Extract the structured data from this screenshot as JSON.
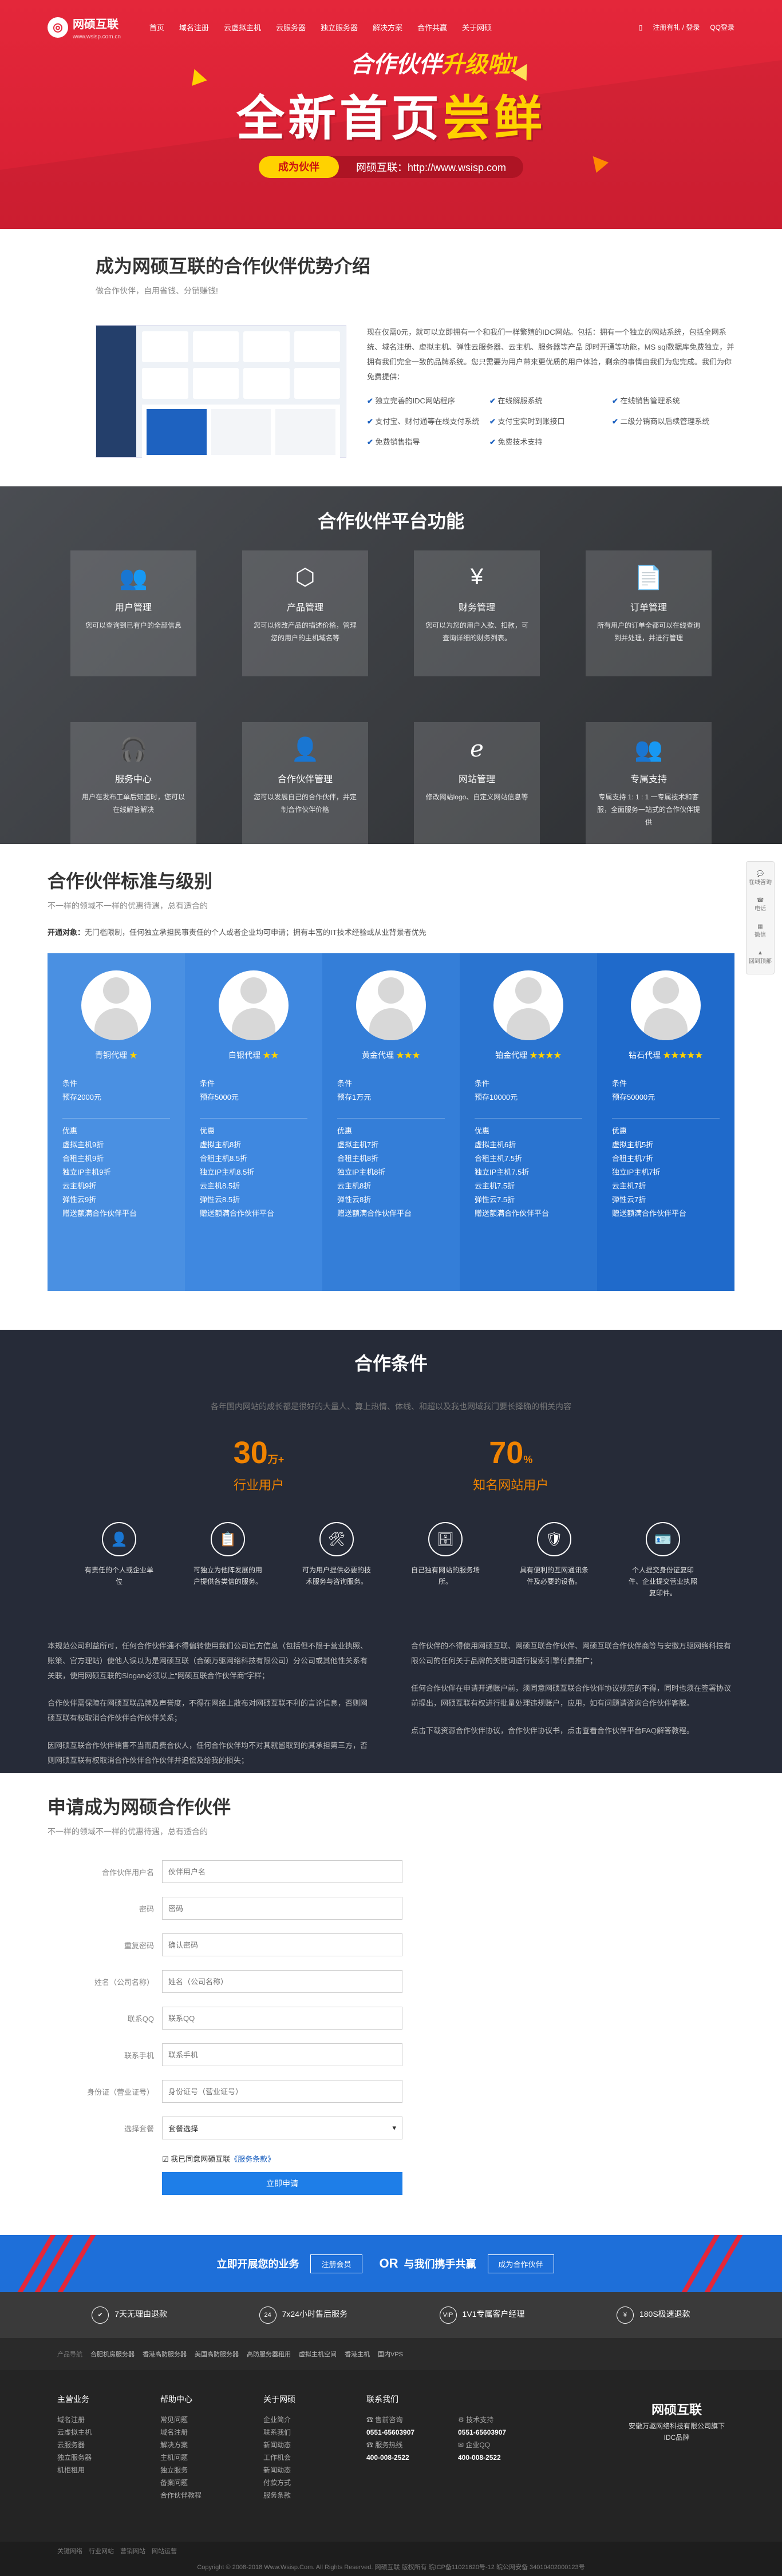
{
  "header": {
    "logo_name": "网硕互联",
    "logo_sub": "www.wsisp.com.cn",
    "nav": [
      "首页",
      "域名注册",
      "云虚拟主机",
      "云服务器",
      "独立服务器",
      "解决方案",
      "合作共赢",
      "关于网硕"
    ],
    "right": [
      "注册有礼 / 登录",
      "QQ登录"
    ]
  },
  "hero": {
    "sub_a": "合作伙伴",
    "sub_b": "升级啦!",
    "main_a": "全新首页",
    "main_b": "尝鲜",
    "pill": "成为伙伴",
    "url": "网硕互联：http://www.wsisp.com"
  },
  "intro": {
    "title": "成为网硕互联的合作伙伴优势介绍",
    "subtitle": "做合作伙伴，自用省钱、分销赚钱!",
    "text": "现在仅需0元，就可以立即拥有一个和我们一样繁殖的IDC网站。包括：拥有一个独立的网站系统，包括全网系统、域名注册、虚拟主机、弹性云服务器、云主机、服务器等产品 即时开通等功能，MS sql数据库免费独立，并拥有我们完全一致的品牌系统。您只需要为用户带来更优质的用户体验，剩余的事情由我们为您完成。我们为你免费提供：",
    "checks": [
      "独立完善的IDC网站程序",
      "在线解服系统",
      "在线销售管理系统",
      "支付宝、财付通等在线支付系统",
      "支付宝实时到账接口",
      "二级分销商以后续管理系统",
      "免费销售指导",
      "免费技术支持"
    ]
  },
  "platform": {
    "title": "合作伙伴平台功能",
    "items": [
      {
        "title": "用户管理",
        "desc": "您可以查询到已有户的全部信息",
        "icon": "users-icon",
        "glyph": "👥"
      },
      {
        "title": "产品管理",
        "desc": "您可以修改产品的描述价格，管理您的用户的主机域名等",
        "icon": "box-icon",
        "glyph": "⬡"
      },
      {
        "title": "财务管理",
        "desc": "您可以为您的用户入款、扣款，可查询详细的财务列表。",
        "icon": "money-icon",
        "glyph": "¥"
      },
      {
        "title": "订单管理",
        "desc": "所有用户的订单全都可以在线查询到并处理，并进行管理",
        "icon": "order-icon",
        "glyph": "📄"
      },
      {
        "title": "服务中心",
        "desc": "用户在发布工单后知道时，您可以在线解答解决",
        "icon": "headset-icon",
        "glyph": "🎧"
      },
      {
        "title": "合作伙伴管理",
        "desc": "您可以发展自己的合作伙伴，并定制合作伙伴价格",
        "icon": "partner-icon",
        "glyph": "👤"
      },
      {
        "title": "网站管理",
        "desc": "修改网站logo、自定义网站信息等",
        "icon": "ie-icon",
        "glyph": "ℯ"
      },
      {
        "title": "专属支持",
        "desc": "专属支持 1: 1 : 1 一专属技术和客服，全面服务一站式的合作伙伴提供",
        "icon": "support-icon",
        "glyph": "👥"
      }
    ]
  },
  "levels": {
    "title": "合作伙伴标准与级别",
    "subtitle": "不一样的领域不一样的优惠待遇，总有适合的",
    "open_label": "开通对象：",
    "open_text": "无门槛限制，任何独立承担民事责任的个人或者企业均可申请；拥有丰富的IT技术经验或从业背景者优先",
    "tiers": [
      {
        "name": "青铜代理",
        "stars": "★",
        "cond_label": "条件",
        "cond": "预存2000元",
        "perks_label": "优惠",
        "perks": [
          "虚拟主机9折",
          "合租主机9折",
          "独立IP主机9折",
          "云主机9折",
          "弹性云9折",
          "赠送额满合作伙伴平台"
        ],
        "color": "#4a90e2"
      },
      {
        "name": "白银代理",
        "stars": "★★",
        "cond_label": "条件",
        "cond": "预存5000元",
        "perks_label": "优惠",
        "perks": [
          "虚拟主机8折",
          "合租主机8.5折",
          "独立IP主机8.5折",
          "云主机8.5折",
          "弹性云8.5折",
          "赠送额满合作伙伴平台"
        ],
        "color": "#3f88e0"
      },
      {
        "name": "黄金代理",
        "stars": "★★★",
        "cond_label": "条件",
        "cond": "预存1万元",
        "perks_label": "优惠",
        "perks": [
          "虚拟主机7折",
          "合租主机8折",
          "独立IP主机8折",
          "云主机8折",
          "弹性云8折",
          "赠送额满合作伙伴平台"
        ],
        "color": "#347ed8"
      },
      {
        "name": "铂金代理",
        "stars": "★★★★",
        "cond_label": "条件",
        "cond": "预存10000元",
        "perks_label": "优惠",
        "perks": [
          "虚拟主机6折",
          "合租主机7.5折",
          "独立IP主机7.5折",
          "云主机7.5折",
          "弹性云7.5折",
          "赠送额满合作伙伴平台"
        ],
        "color": "#2a74d0"
      },
      {
        "name": "钻石代理",
        "stars": "★★★★★",
        "cond_label": "条件",
        "cond": "预存50000元",
        "perks_label": "优惠",
        "perks": [
          "虚拟主机5折",
          "合租主机7折",
          "独立IP主机7折",
          "云主机7折",
          "弹性云7折",
          "赠送额满合作伙伴平台"
        ],
        "color": "#1f6acb"
      }
    ],
    "side_tools": [
      "在线咨询",
      "电话",
      "微信",
      "回到顶部"
    ]
  },
  "conditions": {
    "title": "合作条件",
    "subtitle": "各年国内网站的成长都是很好的大量人、算上热情、体线、和超以及我也网域我门要长择确的相关内容",
    "stats": [
      {
        "value": "30",
        "unit": "万+",
        "label": "行业用户"
      },
      {
        "value": "70",
        "unit": "%",
        "label": "知名网站用户"
      }
    ],
    "icons": [
      {
        "icon": "person-icon",
        "glyph": "👤",
        "text": "有责任的个人或企业单位"
      },
      {
        "icon": "document-icon",
        "glyph": "📋",
        "text": "可独立为他阵发展的用户提供各类信的服务。"
      },
      {
        "icon": "tools-icon",
        "glyph": "🛠",
        "text": "可为用户提供必要的技术服务与咨询服务。"
      },
      {
        "icon": "server-icon",
        "glyph": "🗄",
        "text": "自己独有网站的服务场所。"
      },
      {
        "icon": "shield-icon",
        "glyph": "🛡",
        "text": "具有便利的互网通讯条件及必要的设备。"
      },
      {
        "icon": "id-card-icon",
        "glyph": "🪪",
        "text": "个人提交身份证复印件、企业提交营业执照复印件。"
      }
    ],
    "terms_left": [
      "本规范公司利益所可，任何合作伙伴通不得偏转使用我们公司官方信息（包括但不限于营业执照、账策、官方理站）使他人误以为是网硕互联（合硕万驱网络科技有限公司）分公司或其他性关系有关联，使用网硕互联的Slogan必须以上“网硕互联合作伙伴商”字样；",
      "合作伙伴需保障在网硕互联品牌及声誉度，不得在网络上散布对网硕互联不利的言论信息，否则网硕互联有权取消合作伙伴合作伙伴关系；",
      "因网硕互联合作伙伴销售不当而肩费合伙人，任何合作伙伴均不对其就留取到的其承担第三方，否则网硕互联有权取消合作伙伴合作伙伴并追偿及给我的损失；"
    ],
    "terms_right": [
      "合作伙伴的不得使用网硕互联、网硕互联合作伙伴、网硕互联合作伙伴商等与安徽万驱网络科技有限公司的任何关于品牌的关键词进行搜索引擎付费推广；",
      "任何合作伙伴在申请开通账户前，须同意网硕互联合作伙伴协议规范的不得，同时也须在签署协议前提出，网硕互联有权进行批量处理违规账户，应用，如有问题请咨询合作伙伴客服。",
      "点击下载资源合作伙伴协议，合作伙伴协议书，点击查看合作伙伴平台FAQ解答教程。"
    ]
  },
  "apply": {
    "title": "申请成为网硕合作伙伴",
    "subtitle": "不一样的领域不一样的优惠待遇，总有适合的",
    "fields": [
      {
        "label": "合作伙伴用户名",
        "placeholder": "伙伴用户名"
      },
      {
        "label": "密码",
        "placeholder": "密码"
      },
      {
        "label": "重复密码",
        "placeholder": "确认密码"
      },
      {
        "label": "姓名（公司名称）",
        "placeholder": "姓名（公司名称）"
      },
      {
        "label": "联系QQ",
        "placeholder": "联系QQ"
      },
      {
        "label": "联系手机",
        "placeholder": "联系手机"
      },
      {
        "label": "身份证（营业证号）",
        "placeholder": "身份证号（营业证号）"
      }
    ],
    "select_label": "选择套餐",
    "select_value": "套餐选择",
    "agree_text": "我已同意网硕互联",
    "agree_link": "《服务条款》",
    "submit": "立即申请"
  },
  "banner": {
    "a": "立即开展您的业务",
    "btn1": "注册会员",
    "or": "OR",
    "b": "与我们携手共赢",
    "btn2": "成为合作伙伴"
  },
  "features": [
    {
      "icon": "shield-check-icon",
      "glyph": "✔",
      "text": "7天无理由退款"
    },
    {
      "icon": "clock-icon",
      "glyph": "24",
      "text": "7x24小时售后服务"
    },
    {
      "icon": "vip-icon",
      "glyph": "VIP",
      "text": "1V1专属客户经理"
    },
    {
      "icon": "money-back-icon",
      "glyph": "¥",
      "text": "180S极速退款"
    }
  ],
  "links": {
    "label": "产品导航",
    "items": [
      "合肥机房服务器",
      "香港高防服务器",
      "美国高防服务器",
      "高防服务器租用",
      "虚拟主机空间",
      "香港主机",
      "国内VPS"
    ]
  },
  "footer": {
    "cols": [
      {
        "title": "主营业务",
        "items": [
          "域名注册",
          "云虚拟主机",
          "云服务器",
          "独立服务器",
          "机柜租用"
        ]
      },
      {
        "title": "帮助中心",
        "items": [
          "常见问题",
          "域名注册",
          "解决方案",
          "主机问题",
          "独立服务",
          "备案问题",
          "合作伙伴教程"
        ]
      },
      {
        "title": "关于网硕",
        "items": [
          "企业简介",
          "联系我们",
          "新闻动态",
          "工作机会",
          "新闻动态",
          "付款方式",
          "服务条款"
        ]
      }
    ],
    "contact_title": "联系我们",
    "contact": [
      {
        "label": "售前咨询",
        "value": "0551-65603907"
      },
      {
        "label": "技术支持",
        "value": "0551-65603907"
      },
      {
        "label": "服务热线",
        "value": "400-008-2522"
      },
      {
        "label": "企业QQ",
        "value": "400-008-2522"
      }
    ],
    "brand": "网硕互联",
    "brand_line": "安徽万驱网络科技有限公司旗下",
    "brand_sub": "IDC品牌",
    "bottom_links": [
      "关键网络",
      "行业网站",
      "营销网站",
      "网站运营"
    ],
    "copyright": "Copyright © 2008-2018 Www.Wsisp.Com. All Rights Reserved. 网硕互联 版权所有 皖ICP备11021620号-12 皖公网安备 34010402000123号"
  }
}
